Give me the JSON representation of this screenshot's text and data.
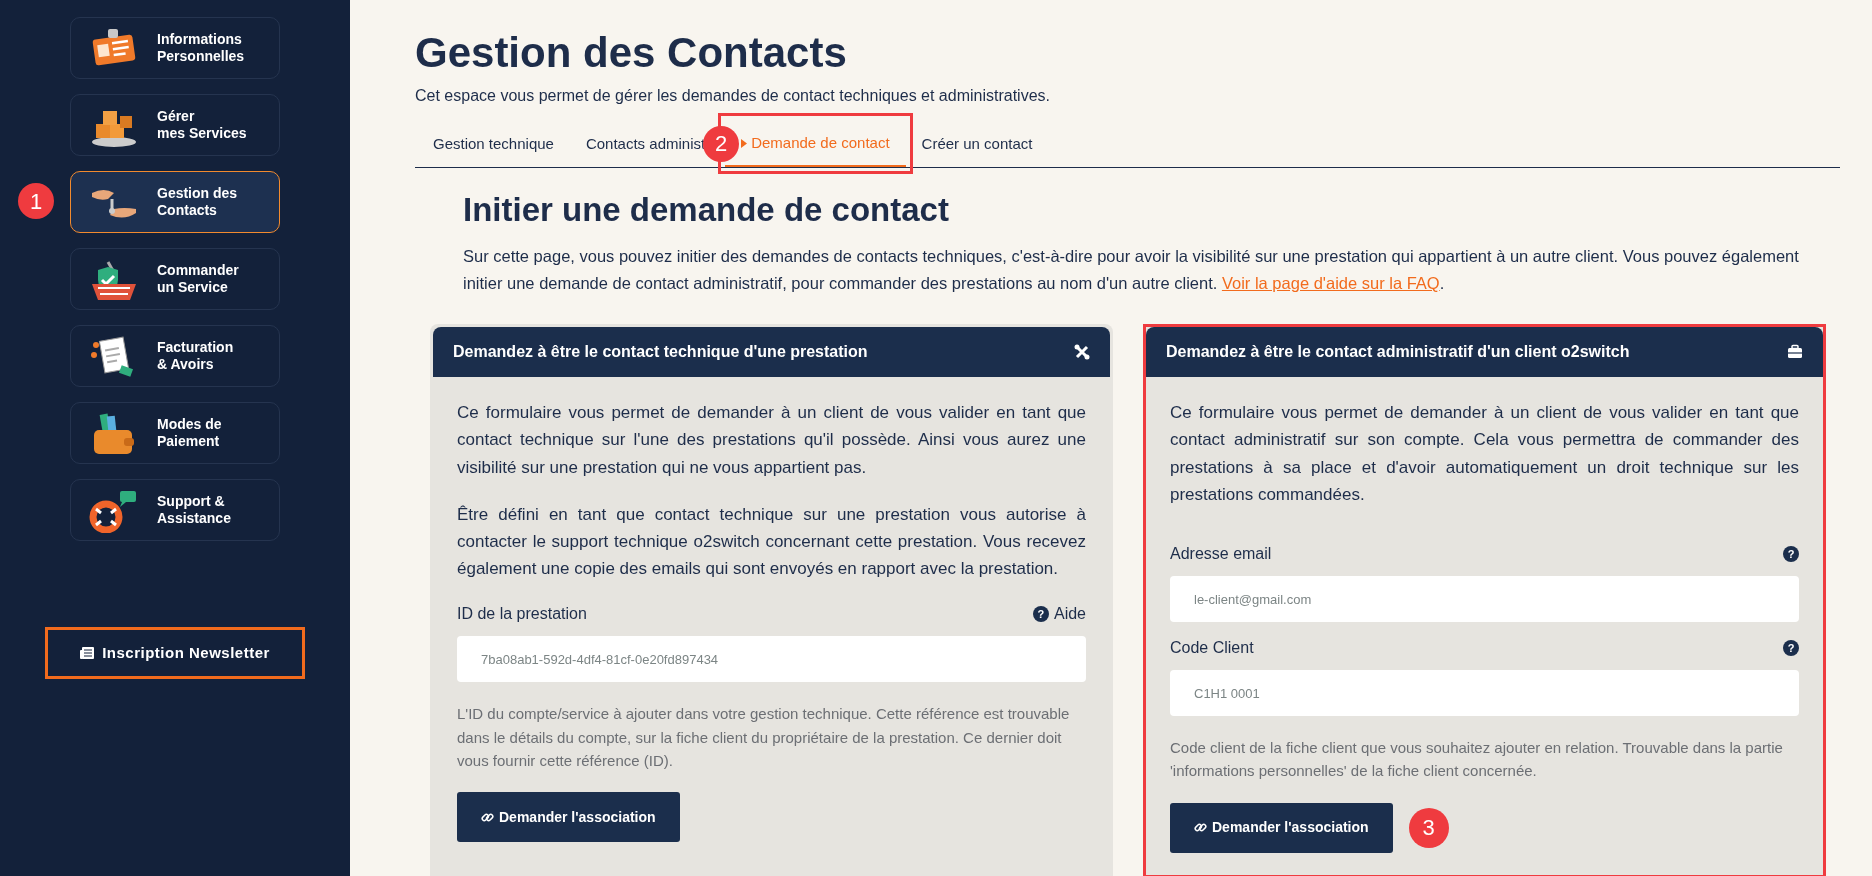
{
  "sidebar": {
    "items": [
      {
        "label": "Informations\nPersonnelles",
        "selected": false
      },
      {
        "label": "Gérer\nmes Services",
        "selected": false
      },
      {
        "label": "Gestion des\nContacts",
        "selected": true,
        "marker": "1"
      },
      {
        "label": "Commander\nun Service",
        "selected": false
      },
      {
        "label": "Facturation\n& Avoirs",
        "selected": false
      },
      {
        "label": "Modes de\nPaiement",
        "selected": false
      },
      {
        "label": "Support &\nAssistance",
        "selected": false
      }
    ],
    "newsletter_button": "Inscription Newsletter"
  },
  "header": {
    "title": "Gestion des Contacts",
    "subtitle": "Cet espace vous permet de gérer les demandes de contact techniques et administratives."
  },
  "tabs": [
    {
      "label": "Gestion technique",
      "selected": false,
      "highlighted": false
    },
    {
      "label": "Contacts administ",
      "selected": false,
      "highlighted": false,
      "marker": "2"
    },
    {
      "label": "Demande de contact",
      "selected": true,
      "highlighted": true
    },
    {
      "label": "Créer un contact",
      "selected": false,
      "highlighted": false
    }
  ],
  "section": {
    "title": "Initier une demande de contact",
    "intro": "Sur cette page, vous pouvez initier des demandes de contacts techniques, c'est-à-dire pour avoir la visibilité sur une prestation qui appartient à un autre client. Vous pouvez également initier une demande de contact administratif, pour commander des prestations au nom d'un autre client.",
    "intro_link": "Voir la page d'aide sur la FAQ",
    "intro_end": "."
  },
  "cards": [
    {
      "title": "Demandez à être le contact technique d'une prestation",
      "highlighted": false,
      "paragraphs": [
        "Ce formulaire vous permet de demander à un client de vous valider en tant que contact technique sur l'une des prestations qu'il possède. Ainsi vous aurez une visibilité sur une prestation qui ne vous appartient pas.",
        "Être défini en tant que contact technique sur une prestation vous autorise à contacter le support technique o2switch concernant cette prestation. Vous recevez également une copie des emails qui sont envoyés en rapport avec la prestation."
      ],
      "fields": [
        {
          "label": "ID de la prestation",
          "help_icon": "?",
          "help": "Aide",
          "placeholder": "7ba08ab1-592d-4df4-81cf-0e20fd897434"
        }
      ],
      "hint": "L'ID du compte/service à ajouter dans votre gestion technique. Cette référence est trouvable dans le détails du compte, sur la fiche client du propriétaire de la prestation. Ce dernier doit vous fournir cette référence (ID).",
      "button": "Demander l'association"
    },
    {
      "title": "Demandez à être le contact administratif d'un client o2switch",
      "highlighted": true,
      "paragraphs": [
        "Ce formulaire vous permet de demander à un client de vous valider en tant que contact administratif sur son compte. Cela vous permettra de commander des prestations à sa place et d'avoir automatiquement un droit technique sur les prestations commandées."
      ],
      "fields": [
        {
          "label": "Adresse email",
          "help_icon": "?",
          "placeholder": "le-client@gmail.com"
        },
        {
          "label": "Code Client",
          "help_icon": "?",
          "placeholder": "C1H1 0001"
        }
      ],
      "hint": "Code client de la fiche client que vous souhaitez ajouter en relation. Trouvable dans la partie 'informations personnelles' de la fiche client concernée.",
      "button": "Demander l'association",
      "button_marker": "3"
    }
  ]
}
